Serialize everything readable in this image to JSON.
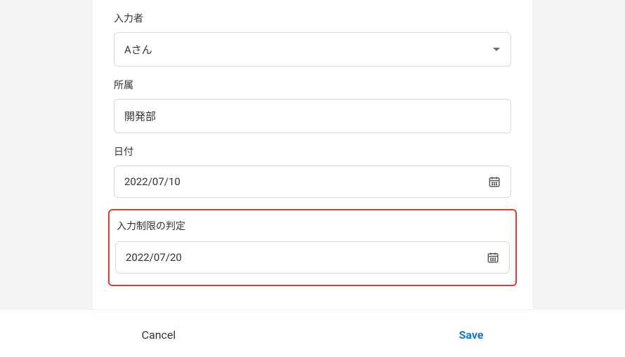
{
  "fields": {
    "inputPerson": {
      "label": "入力者",
      "value": "Aさん"
    },
    "department": {
      "label": "所属",
      "value": "開発部"
    },
    "date": {
      "label": "日付",
      "value": "2022/07/10"
    },
    "restrictionJudgment": {
      "label": "入力制限の判定",
      "value": "2022/07/20"
    }
  },
  "actions": {
    "cancel": "Cancel",
    "save": "Save"
  }
}
